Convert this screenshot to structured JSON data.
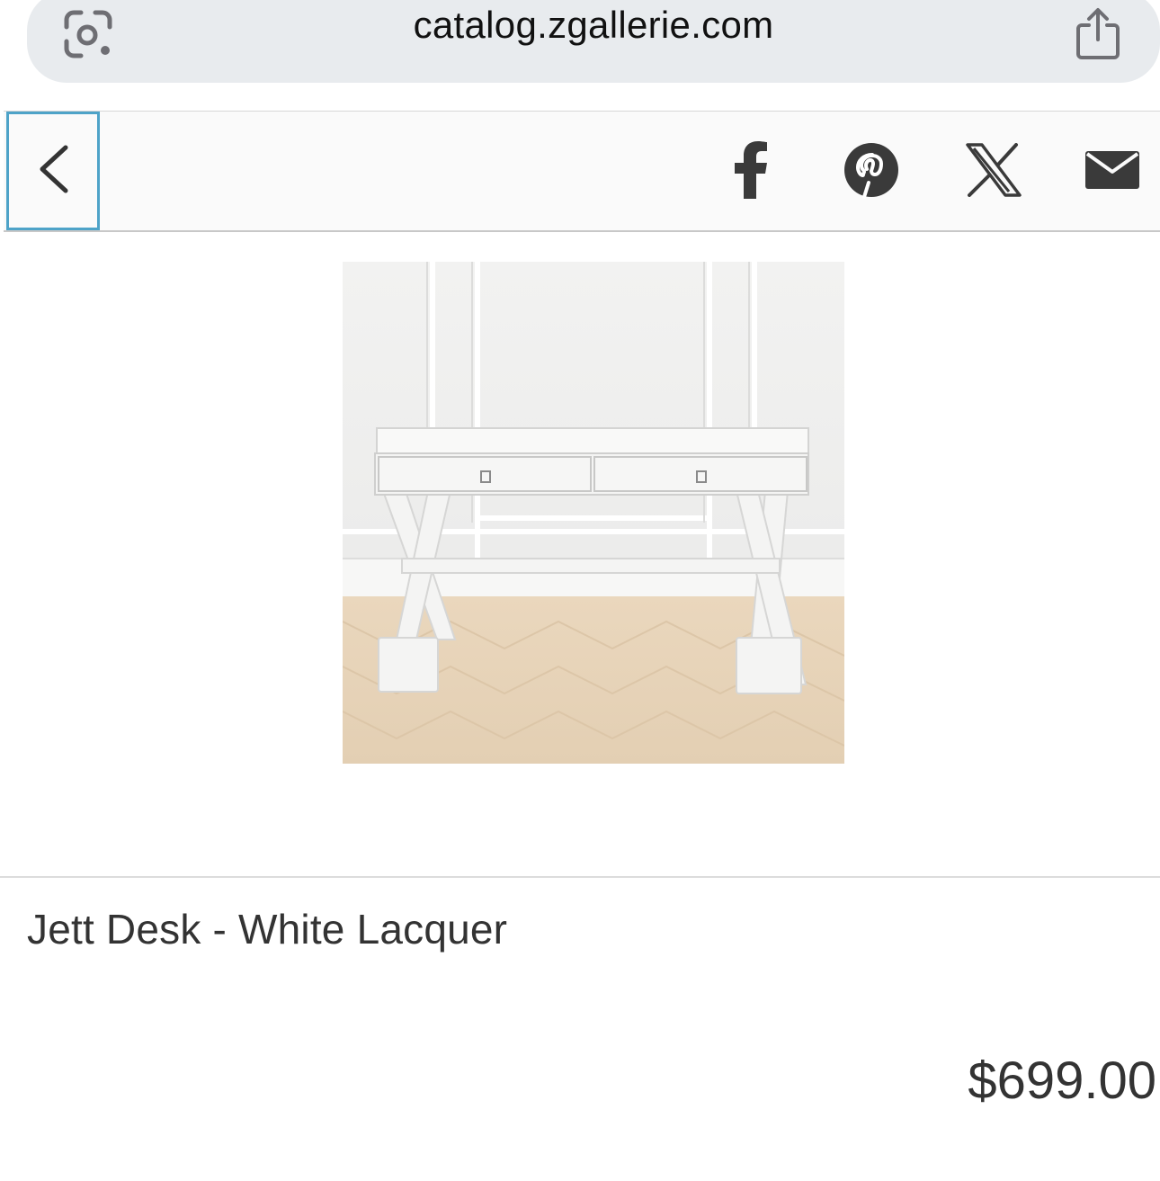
{
  "browser": {
    "url": "catalog.zgallerie.com",
    "lens_icon": "camera-search-icon",
    "share_icon": "share-icon"
  },
  "toolbar": {
    "back_icon": "chevron-left-icon",
    "social_icons": [
      "facebook-icon",
      "pinterest-icon",
      "x-icon",
      "mail-icon"
    ],
    "accent_color": "#4ea3c8"
  },
  "product": {
    "title": "Jett Desk - White Lacquer",
    "price": "$699.00"
  }
}
